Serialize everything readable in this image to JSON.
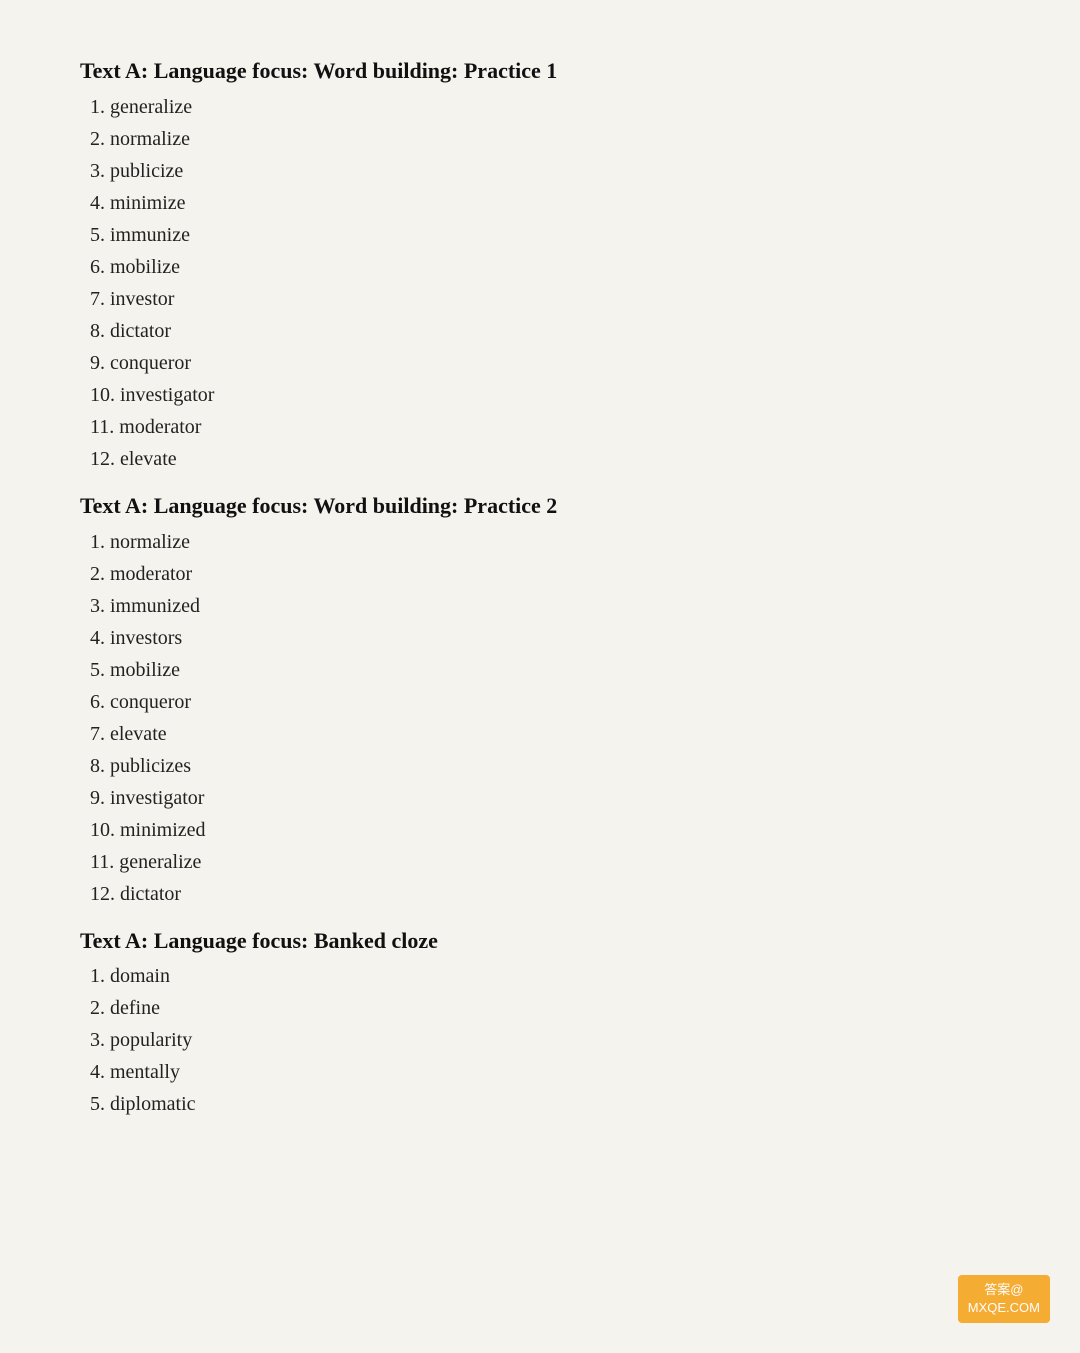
{
  "sections": [
    {
      "id": "practice1",
      "title": "Text A: Language focus: Word building: Practice 1",
      "items": [
        "1. generalize",
        "2. normalize",
        "3. publicize",
        "4. minimize",
        "5. immunize",
        "6. mobilize",
        "7. investor",
        "8. dictator",
        "9. conqueror",
        "10. investigator",
        "11. moderator",
        "12. elevate"
      ]
    },
    {
      "id": "practice2",
      "title": "Text A: Language focus: Word building: Practice 2",
      "items": [
        "1. normalize",
        "2. moderator",
        "3. immunized",
        "4. investors",
        "5. mobilize",
        "6. conqueror",
        "7. elevate",
        "8. publicizes",
        "9. investigator",
        "10. minimized",
        "11. generalize",
        "12. dictator"
      ]
    },
    {
      "id": "banked-cloze",
      "title": "Text A: Language focus: Banked cloze",
      "items": [
        "1. domain",
        "2. define",
        "3. popularity",
        "4. mentally",
        "5. diplomatic"
      ]
    }
  ],
  "watermark": {
    "line1": "答案@",
    "line2": "MXQE.COM"
  }
}
